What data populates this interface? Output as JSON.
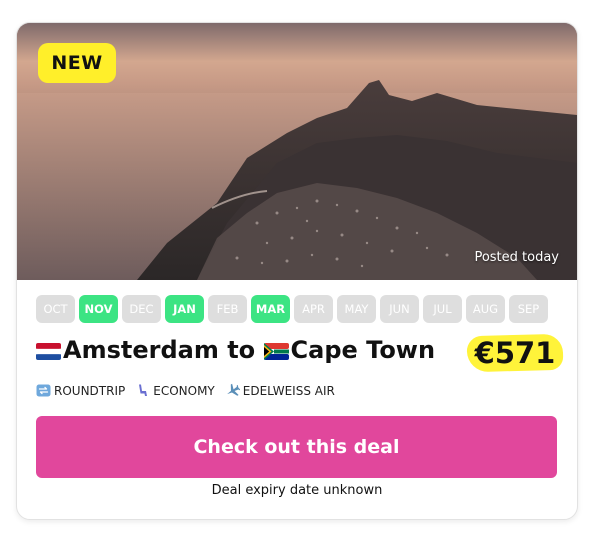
{
  "badge": {
    "label": "NEW"
  },
  "hero": {
    "posted": "Posted today"
  },
  "months": [
    {
      "label": "OCT",
      "active": false
    },
    {
      "label": "NOV",
      "active": true
    },
    {
      "label": "DEC",
      "active": false
    },
    {
      "label": "JAN",
      "active": true
    },
    {
      "label": "FEB",
      "active": false
    },
    {
      "label": "MAR",
      "active": true
    },
    {
      "label": "APR",
      "active": false
    },
    {
      "label": "MAY",
      "active": false
    },
    {
      "label": "JUN",
      "active": false
    },
    {
      "label": "JUL",
      "active": false
    },
    {
      "label": "AUG",
      "active": false
    },
    {
      "label": "SEP",
      "active": false
    }
  ],
  "route": {
    "origin": "Amsterdam",
    "connector": " to ",
    "destination": "Cape Town",
    "origin_flag": "netherlands-flag",
    "destination_flag": "south-africa-flag"
  },
  "price": {
    "value": "€571"
  },
  "meta": {
    "trip_type": "ROUNDTRIP",
    "trip_icon": "roundtrip-icon",
    "cabin": "ECONOMY",
    "cabin_icon": "seat-icon",
    "airline": "EDELWEISS AIR",
    "airline_icon": "airplane-icon"
  },
  "cta": {
    "label": "Check out this deal"
  },
  "expiry": {
    "text": "Deal expiry date unknown"
  },
  "colors": {
    "badge": "#ffef2a",
    "month_active": "#3ce483",
    "month_inactive": "#dedede",
    "cta": "#e1479c",
    "price_highlight": "#fff33a"
  }
}
